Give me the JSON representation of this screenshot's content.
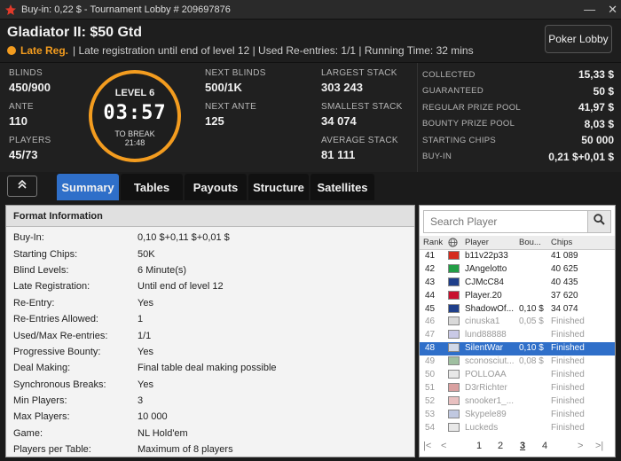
{
  "window": {
    "title": "Buy-in: 0,22 $ - Tournament Lobby # 209697876",
    "min": "—",
    "close": "✕"
  },
  "header": {
    "name": "Gladiator II: $50 Gtd",
    "late_label": "Late Reg.",
    "details": "| Late registration until end of level 12 | Used Re-entries: 1/1 | Running Time: 32 mins",
    "lobby_button": "Poker Lobby"
  },
  "stats": {
    "blinds_label": "BLINDS",
    "blinds": "450/900",
    "ante_label": "ANTE",
    "ante": "110",
    "players_label": "PLAYERS",
    "players": "45/73",
    "level": "LEVEL 6",
    "time": "03:57",
    "to_break_label": "TO BREAK",
    "to_break": "21:48",
    "next_blinds_label": "NEXT BLINDS",
    "next_blinds": "500/1K",
    "next_ante_label": "NEXT ANTE",
    "next_ante": "125",
    "largest_label": "LARGEST STACK",
    "largest": "303 243",
    "smallest_label": "SMALLEST STACK",
    "smallest": "34 074",
    "average_label": "AVERAGE STACK",
    "average": "81 111"
  },
  "prize": [
    {
      "label": "COLLECTED",
      "value": "15,33 $"
    },
    {
      "label": "GUARANTEED",
      "value": "50 $"
    },
    {
      "label": "REGULAR PRIZE POOL",
      "value": "41,97 $"
    },
    {
      "label": "BOUNTY PRIZE POOL",
      "value": "8,03 $"
    },
    {
      "label": "STARTING CHIPS",
      "value": "50 000"
    },
    {
      "label": "BUY-IN",
      "value": "0,21 $+0,01 $"
    }
  ],
  "tabs": [
    "Summary",
    "Tables",
    "Payouts",
    "Structure",
    "Satellites"
  ],
  "format": {
    "heading": "Format Information",
    "rows": [
      {
        "k": "Buy-In:",
        "v": "0,10 $+0,11 $+0,01 $"
      },
      {
        "k": "Starting Chips:",
        "v": "50K"
      },
      {
        "k": "Blind Levels:",
        "v": "6 Minute(s)"
      },
      {
        "k": "Late Registration:",
        "v": "Until end of level 12"
      },
      {
        "k": "Re-Entry:",
        "v": "Yes"
      },
      {
        "k": "Re-Entries Allowed:",
        "v": "1"
      },
      {
        "k": "Used/Max Re-entries:",
        "v": "1/1"
      },
      {
        "k": "Progressive Bounty:",
        "v": "Yes"
      },
      {
        "k": "Deal Making:",
        "v": "Final table deal making possible"
      },
      {
        "k": "Synchronous Breaks:",
        "v": "Yes"
      },
      {
        "k": "Min Players:",
        "v": "3"
      },
      {
        "k": "Max Players:",
        "v": "10 000"
      },
      {
        "k": "Game:",
        "v": "NL Hold'em"
      },
      {
        "k": "Players per Table:",
        "v": "Maximum of 8 players"
      }
    ]
  },
  "players": {
    "search_placeholder": "Search Player",
    "headers": {
      "rank": "Rank",
      "player": "Player",
      "bounty": "Bou...",
      "chips": "Chips"
    },
    "rows": [
      {
        "rank": "41",
        "name": "b11v22p33",
        "bounty": "",
        "chips": "41 089",
        "flag": "#d52b1e",
        "state": "active"
      },
      {
        "rank": "42",
        "name": "JAngelotto",
        "bounty": "",
        "chips": "40 625",
        "flag": "#229e45",
        "state": "active"
      },
      {
        "rank": "43",
        "name": "CJMcC84",
        "bounty": "",
        "chips": "40 435",
        "flag": "#1f3f8a",
        "state": "active"
      },
      {
        "rank": "44",
        "name": "Player.20",
        "bounty": "",
        "chips": "37 620",
        "flag": "#c8102e",
        "state": "active"
      },
      {
        "rank": "45",
        "name": "ShadowOf...",
        "bounty": "0,10 $",
        "chips": "34 074",
        "flag": "#1f3f8a",
        "state": "active"
      },
      {
        "rank": "46",
        "name": "cinuska1",
        "bounty": "0,05 $",
        "chips": "Finished",
        "flag": "#d9d9d9",
        "state": "finished"
      },
      {
        "rank": "47",
        "name": "lund88888",
        "bounty": "",
        "chips": "Finished",
        "flag": "#c9c9e6",
        "state": "finished"
      },
      {
        "rank": "48",
        "name": "SilentWar",
        "bounty": "0,10 $",
        "chips": "Finished",
        "flag": "#d0d8e8",
        "state": "selected"
      },
      {
        "rank": "49",
        "name": "sconosciut...",
        "bounty": "0,08 $",
        "chips": "Finished",
        "flag": "#9fbfa0",
        "state": "finished"
      },
      {
        "rank": "50",
        "name": "POLLOAA",
        "bounty": "",
        "chips": "Finished",
        "flag": "#e8e8e8",
        "state": "finished"
      },
      {
        "rank": "51",
        "name": "D3rRichter",
        "bounty": "",
        "chips": "Finished",
        "flag": "#d9a0a0",
        "state": "finished"
      },
      {
        "rank": "52",
        "name": "snooker1_...",
        "bounty": "",
        "chips": "Finished",
        "flag": "#e8c0c0",
        "state": "finished"
      },
      {
        "rank": "53",
        "name": "Skypele89",
        "bounty": "",
        "chips": "Finished",
        "flag": "#c0c8e0",
        "state": "finished"
      },
      {
        "rank": "54",
        "name": "Luckeds",
        "bounty": "",
        "chips": "Finished",
        "flag": "#e8e8e8",
        "state": "finished"
      }
    ],
    "pager": {
      "first": "|<",
      "prev": "<",
      "pages": [
        "1",
        "2",
        "3",
        "4"
      ],
      "current": "3",
      "next": ">",
      "last": ">|"
    }
  },
  "colors": {
    "accent": "#f39c1f",
    "tab_active": "#2f6fc9"
  }
}
